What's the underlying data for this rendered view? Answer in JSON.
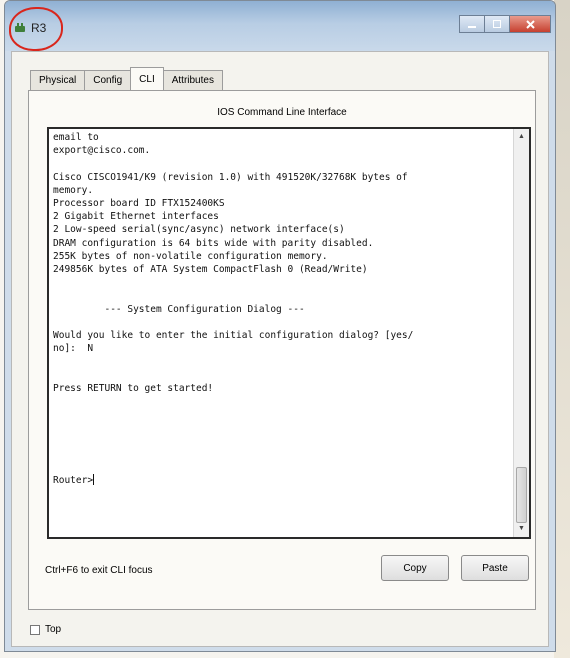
{
  "window": {
    "title": "R3",
    "icon": "router-app-icon",
    "controls": [
      "minimize-icon",
      "maximize-icon",
      "close-icon"
    ]
  },
  "tabs": [
    {
      "label": "Physical",
      "active": false
    },
    {
      "label": "Config",
      "active": false
    },
    {
      "label": "CLI",
      "active": true
    },
    {
      "label": "Attributes",
      "active": false
    }
  ],
  "panel": {
    "title": "IOS Command Line Interface"
  },
  "terminal": {
    "lines": [
      "email to",
      "export@cisco.com.",
      "",
      "Cisco CISCO1941/K9 (revision 1.0) with 491520K/32768K bytes of",
      "memory.",
      "Processor board ID FTX152400KS",
      "2 Gigabit Ethernet interfaces",
      "2 Low-speed serial(sync/async) network interface(s)",
      "DRAM configuration is 64 bits wide with parity disabled.",
      "255K bytes of non-volatile configuration memory.",
      "249856K bytes of ATA System CompactFlash 0 (Read/Write)",
      "",
      "",
      "         --- System Configuration Dialog ---",
      "",
      "Would you like to enter the initial configuration dialog? [yes/",
      "no]:  N",
      "",
      "",
      "Press RETURN to get started!",
      "",
      "",
      "",
      "",
      "",
      ""
    ],
    "prompt": "Router>"
  },
  "footer": {
    "hint": "Ctrl+F6 to exit CLI focus",
    "copy_label": "Copy",
    "paste_label": "Paste"
  },
  "bottom": {
    "top_label": "Top",
    "top_checked": false
  },
  "colors": {
    "title_highlight": "#d9261c",
    "terminal_border": "#2a2a2a"
  }
}
